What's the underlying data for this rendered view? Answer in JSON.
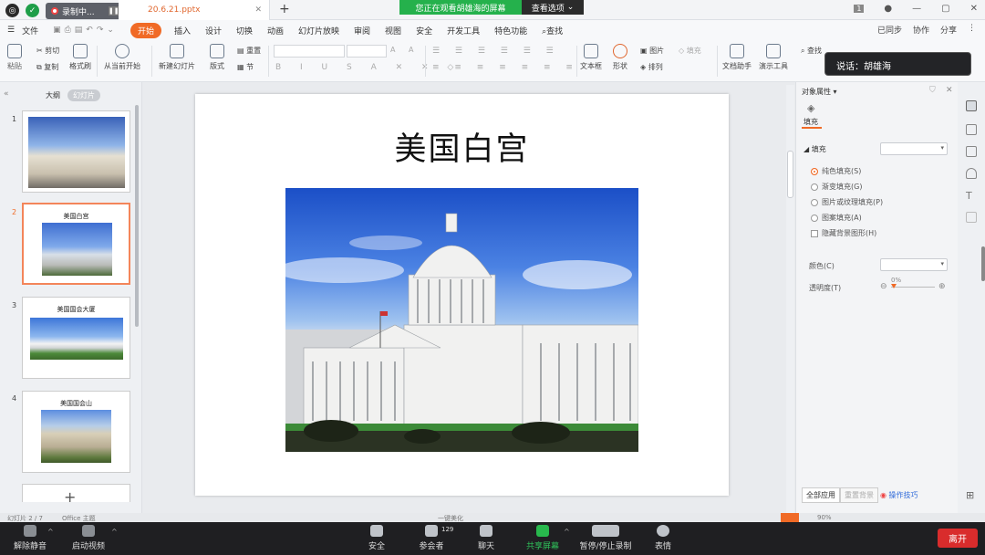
{
  "titlebar": {
    "recording_label": "录制中...",
    "doc_tab": "20.6.21.pptx",
    "sharing_banner": "您正在观看胡雄海的屏幕",
    "view_options": "查看选项",
    "page_badge": "1"
  },
  "menubar": {
    "file": "文件",
    "tabs": [
      "开始",
      "插入",
      "设计",
      "切换",
      "动画",
      "幻灯片放映",
      "审阅",
      "视图",
      "安全",
      "开发工具",
      "特色功能"
    ],
    "search": "查找",
    "right": [
      "已同步",
      "协作",
      "分享"
    ]
  },
  "ribbon": {
    "cut": "剪切",
    "copy": "复制",
    "format_painter": "格式刷",
    "from_current": "从当前开始",
    "new_slide": "新建幻灯片",
    "layout": "版式",
    "reset": "重置",
    "section": "节",
    "textbox": "文本框",
    "shape": "形状",
    "arrange": "排列",
    "picture": "图片",
    "fill": "填充",
    "doc_assistant": "文档助手",
    "presenter_tools": "演示工具",
    "find": "查找",
    "paste": "粘贴"
  },
  "leftpanel": {
    "tab_outline": "大纲",
    "tab_slides": "幻灯片",
    "thumbs": [
      {
        "num": "1",
        "title": ""
      },
      {
        "num": "2",
        "title": "美国白宫"
      },
      {
        "num": "3",
        "title": "美国国会大厦"
      },
      {
        "num": "4",
        "title": "美国国会山"
      }
    ],
    "add": "+"
  },
  "slide": {
    "title": "美国白宫"
  },
  "rightpanel": {
    "title": "对象属性",
    "tab_fill": "填充",
    "section_fill": "填充",
    "options": [
      "纯色填充(S)",
      "渐变填充(G)",
      "图片或纹理填充(P)",
      "图案填充(A)"
    ],
    "hide_bg": "隐藏背景图形(H)",
    "color_label": "颜色(C)",
    "transparency_label": "透明度(T)",
    "transparency_value": "0%",
    "apply_all": "全部应用",
    "reset_bg": "重置背景",
    "tips": "操作技巧"
  },
  "tooltip": "说话：胡雄海",
  "statusbar": {
    "left": "幻灯片 2 / 7",
    "theme": "Office 主题",
    "beautify": "一键美化",
    "zoom": "90%"
  },
  "meeting": {
    "mute": "解除静音",
    "video": "启动视频",
    "security": "安全",
    "participants": "参会者",
    "participants_count": "129",
    "chat": "聊天",
    "share": "共享屏幕",
    "record": "暂停/停止录制",
    "reactions": "表情",
    "leave": "离开"
  }
}
